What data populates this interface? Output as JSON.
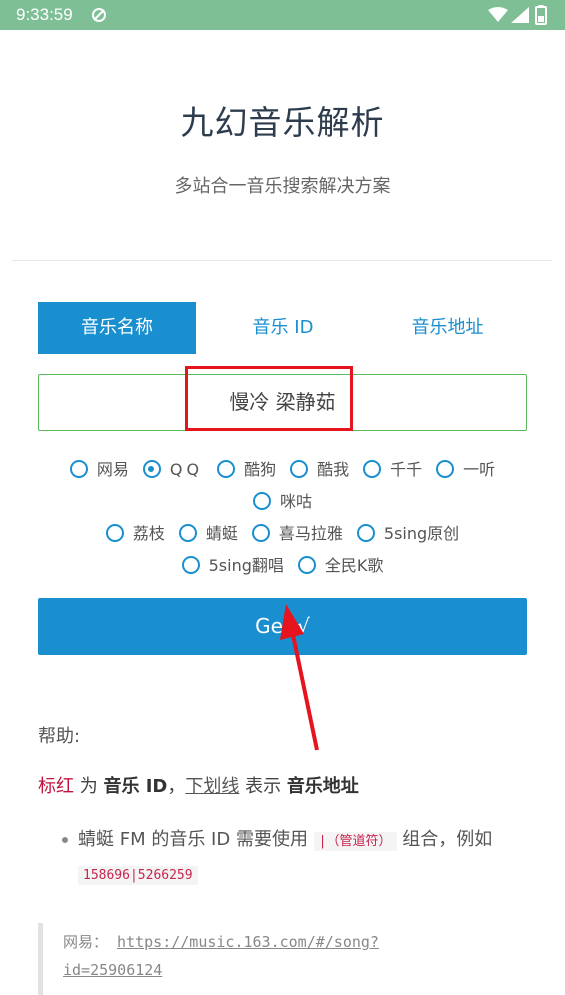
{
  "status_bar": {
    "time": "9:33:59",
    "icons": [
      "notification-icon",
      "wifi-icon",
      "signal-icon",
      "battery-icon"
    ]
  },
  "header": {
    "title": "九幻音乐解析",
    "subtitle": "多站合一音乐搜索解决方案"
  },
  "tabs": [
    {
      "label": "音乐名称",
      "active": true
    },
    {
      "label": "音乐 ID",
      "active": false
    },
    {
      "label": "音乐地址",
      "active": false
    }
  ],
  "search": {
    "value": "慢冷 梁静茹"
  },
  "sources": [
    {
      "label": "网易",
      "checked": false
    },
    {
      "label": "QQ",
      "checked": true
    },
    {
      "label": "酷狗",
      "checked": false
    },
    {
      "label": "酷我",
      "checked": false
    },
    {
      "label": "千千",
      "checked": false
    },
    {
      "label": "一听",
      "checked": false
    },
    {
      "label": "咪咕",
      "checked": false
    },
    {
      "label": "荔枝",
      "checked": false
    },
    {
      "label": "蜻蜓",
      "checked": false
    },
    {
      "label": "喜马拉雅",
      "checked": false
    },
    {
      "label": "5sing原创",
      "checked": false
    },
    {
      "label": "5sing翻唱",
      "checked": false
    },
    {
      "label": "全民K歌",
      "checked": false
    }
  ],
  "get_button": {
    "label": "Get √"
  },
  "help": {
    "title": "帮助:",
    "line_red": "标红",
    "line_w1": " 为 ",
    "line_b1": "音乐 ID",
    "line_w2": "，",
    "line_underline": "下划线",
    "line_w3": " 表示 ",
    "line_b2": "音乐地址",
    "bullet_text1": "蜻蜓 FM 的音乐 ID 需要使用 ",
    "bullet_code1": "|（管道符）",
    "bullet_text2": " 组合，例如 ",
    "bullet_code2": "158696|5266259",
    "quote_label": "网易：",
    "quote_url_part1": "https://music.163.com/#/song?",
    "quote_url_part2": "id=",
    "quote_url_id": "25906124"
  },
  "colors": {
    "status_bar": "#7fbf95",
    "accent": "#1a8fd0",
    "input_border": "#5cb85c",
    "highlight": "#e5141f",
    "code_red": "#c7254e"
  }
}
